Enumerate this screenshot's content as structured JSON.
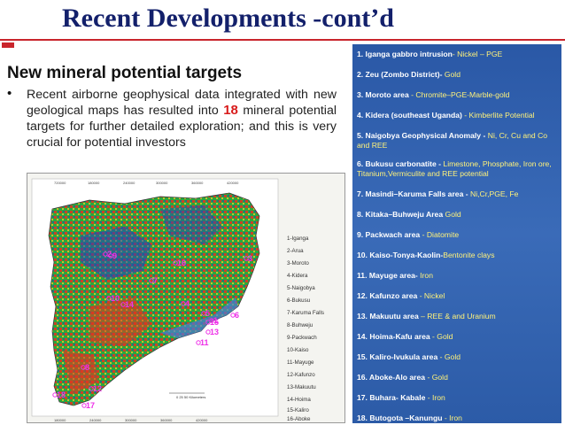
{
  "slide": {
    "title": "Recent Developments -cont’d",
    "heading": "New mineral potential targets",
    "bullet_marker": "•",
    "bullet_before": "Recent airborne geophysical data integrated with new geological maps has resulted into ",
    "bullet_number": "18",
    "bullet_after": " mineral potential targets for further detailed exploration; and this is very crucial for potential investors"
  },
  "map": {
    "scale_text": "0  25  50 Kilometers",
    "top_ticks": [
      "720000",
      "180000",
      "240000",
      "300000",
      "360000",
      "420000"
    ],
    "bottom_ticks": [
      "180000",
      "240000",
      "300000",
      "360000",
      "420000"
    ],
    "legend": [
      "1-Iganga",
      "2-Arua",
      "3-Moroto",
      "4-Kidera",
      "5-Naigobya",
      "6-Bukusu",
      "7-Karuma Falls",
      "8-Buhweju",
      "9-Packwach",
      "10-Kaiso",
      "11-Mayuge",
      "12-Kafunzo",
      "13-Makuutu",
      "14-Hoima",
      "15-Kaliro",
      "16-Aboke"
    ],
    "markers": [
      "1",
      "2",
      "3",
      "4",
      "5",
      "6",
      "7",
      "8",
      "9",
      "10",
      "11",
      "12",
      "13",
      "14",
      "15",
      "16",
      "17",
      "18"
    ],
    "colors": {
      "low": "#1f3fbf",
      "mid": "#1fa83a",
      "high": "#e8321e",
      "marker": "#ee30e8"
    }
  },
  "targets": [
    {
      "name": "1. Iganga gabbro intrusion",
      "mineral": "- Nickel – PGE"
    },
    {
      "name": "2. Zeu  (Zombo District)-",
      "mineral": " Gold"
    },
    {
      "name": "3.  Moroto area ",
      "mineral": "- Chromite–PGE-Marble-gold"
    },
    {
      "name": "4. Kidera (southeast Uganda)",
      "mineral": " - Kimberlite Potential"
    },
    {
      "name": "5. Naigobya Geophysical Anomaly - ",
      "mineral": " Ni, Cr, Cu and Co and REE"
    },
    {
      "name": "6. Bukusu carbonatite - ",
      "mineral": " Limestone, Phosphate, Iron ore, Titanium,Vermiculite and REE potential"
    },
    {
      "name": "7. Masindi–Karuma Falls area -",
      "mineral": "  Ni,Cr,PGE, Fe"
    },
    {
      "name": "8. Kitaka–Buhweju Area",
      "mineral": " Gold"
    },
    {
      "name": "9. Packwach area ",
      "mineral": "- Diatomite"
    },
    {
      "name": "10. Kaiso-Tonya-Kaolin-",
      "mineral": "Bentonite clays"
    },
    {
      "name": "11. Mayuge area-",
      "mineral": " Iron"
    },
    {
      "name": "12. Kafunzo area ",
      "mineral": "- Nickel"
    },
    {
      "name": "13. Makuutu area ",
      "mineral": "– REE & and Uranium"
    },
    {
      "name": "14. Hoima-Kafu  area ",
      "mineral": "- Gold"
    },
    {
      "name": "15. Kaliro-Ivukula area ",
      "mineral": "- Gold"
    },
    {
      "name": "16. Aboke-Alo area ",
      "mineral": "- Gold"
    },
    {
      "name": "17. Buhara- Kabale ",
      "mineral": "- Iron"
    },
    {
      "name": "18. Butogota –Kanungu ",
      "mineral": "- Iron"
    }
  ]
}
